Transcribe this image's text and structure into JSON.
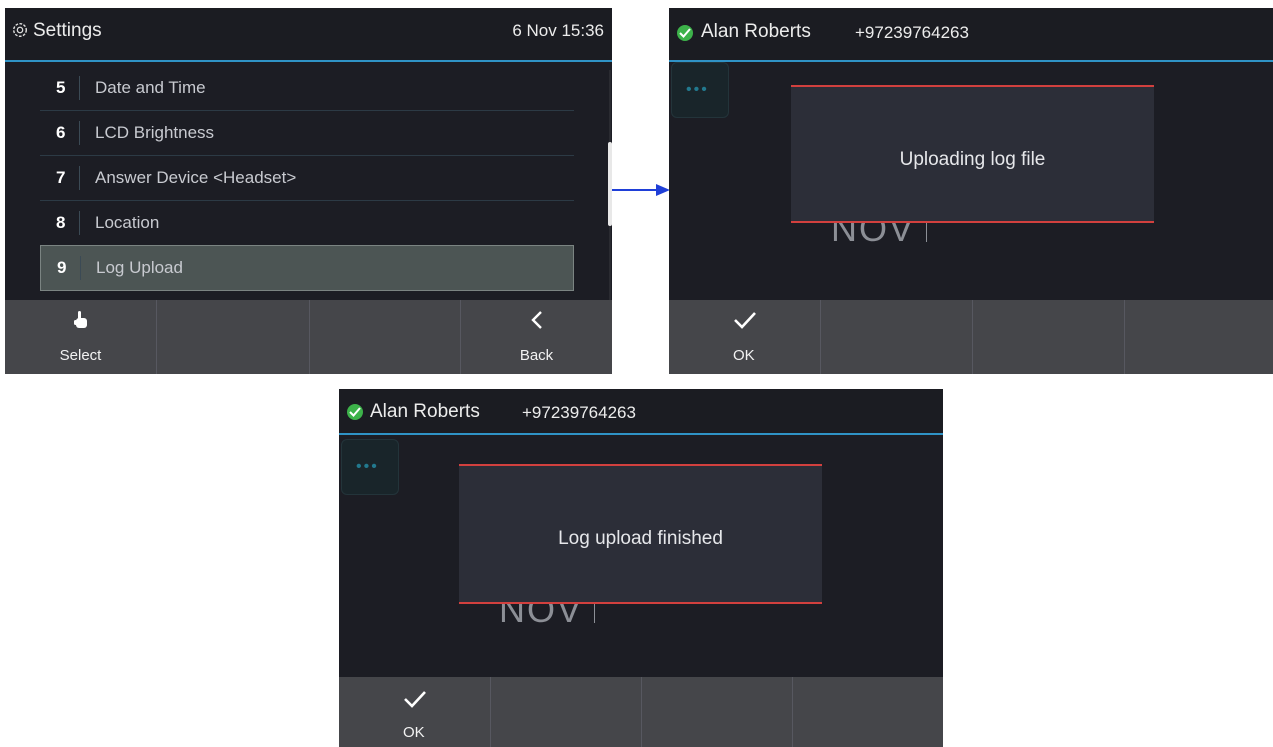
{
  "screen1": {
    "header": {
      "title": "Settings",
      "datetime": "6 Nov 15:36"
    },
    "menu_items": [
      {
        "num": "5",
        "label": "Date and Time"
      },
      {
        "num": "6",
        "label": "LCD Brightness"
      },
      {
        "num": "7",
        "label": "Answer Device <Headset>"
      },
      {
        "num": "8",
        "label": "Location"
      },
      {
        "num": "9",
        "label": "Log Upload"
      }
    ],
    "softkeys": {
      "select": "Select",
      "back": "Back"
    }
  },
  "screen2": {
    "contact": {
      "name": "Alan Roberts",
      "number": "+97239764263"
    },
    "background_text": "NOV",
    "dialog_message": "Uploading log file",
    "softkeys": {
      "ok": "OK"
    }
  },
  "screen3": {
    "contact": {
      "name": "Alan Roberts",
      "number": "+97239764263"
    },
    "background_text": "NOV",
    "dialog_message": "Log upload finished",
    "softkeys": {
      "ok": "OK"
    }
  },
  "colors": {
    "accent_line": "#2f93c6",
    "dialog_border": "#d2403e",
    "status_green": "#3db24a",
    "arrow": "#1f3fd8"
  },
  "icons": [
    "gear-icon",
    "hand-pointer-icon",
    "chevron-left-icon",
    "checkmark-icon",
    "status-check-icon",
    "more-dots-icon",
    "arrow-right-icon"
  ]
}
